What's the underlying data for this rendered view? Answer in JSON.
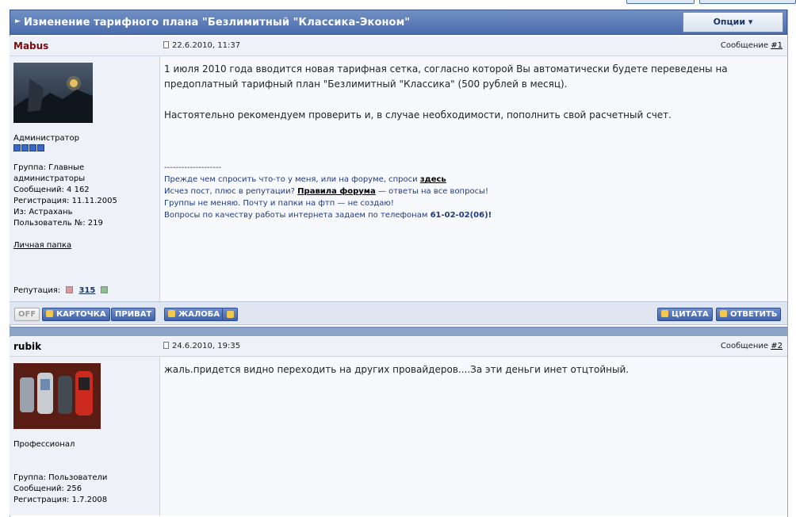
{
  "topic": {
    "title": "Изменение тарифного плана \"Безлимитный \"Классика-Эконом\"",
    "options_label": "Опции ▾"
  },
  "posts": [
    {
      "author": "Mabus",
      "date": "22.6.2010, 11:37",
      "msg_label": "Сообщение",
      "msg_num": "#1",
      "rank": "Администратор",
      "group": "Группа: Главные администраторы",
      "messages": "Сообщений: 4 162",
      "registered": "Регистрация: 11.11.2005",
      "from": "Из: Астрахань",
      "user_no": "Пользователь №: 219",
      "folder": "Личная папка",
      "rep_label": "Репутация:",
      "rep_value": "315",
      "body_1": "1 июля 2010 года вводится новая тарифная сетка, согласно которой Вы автоматически будете переведены на",
      "body_2": "предоплатный тарифный план \"Безлимитный \"Классика\" (500 рублей в месяц).",
      "body_3": "Настоятельно рекомендуем проверить и, в случае необходимости, пополнить свой расчетный счет.",
      "sig_dash": "--------------------",
      "sig_1a": "Прежде чем спросить что-то у меня, или на форуме, спроси ",
      "sig_1b": "здесь",
      "sig_2a": "Исчез пост, плюс в репутации? ",
      "sig_2b": "Правила форума",
      "sig_2c": " — ответы на все вопросы!",
      "sig_3": "Группы не меняю. Почту и папки на фтп — не создаю!",
      "sig_4a": "Вопросы по качеству работы интернета задаем по телефонам ",
      "sig_4b": "61-02-02(06)!",
      "buttons": {
        "off": "OFF",
        "card": "КАРТОЧКА",
        "private": "ПРИВАТ",
        "report": "ЖАЛОБА",
        "quote": "ЦИТАТА",
        "reply": "ОТВЕТИТЬ"
      }
    },
    {
      "author": "rubik",
      "date": "24.6.2010, 19:35",
      "msg_label": "Сообщение",
      "msg_num": "#2",
      "rank": "Профессионал",
      "group": "Группа: Пользователи",
      "messages": "Сообщений: 256",
      "registered": "Регистрация: 1.7.2008",
      "body_1": "жаль.придется видно переходить на других провайдеров....За эти деньги инет отцтойный."
    }
  ],
  "colors": {
    "title_bar": "#5a7bb8",
    "admin_name": "#7a0c0c",
    "button_blue": "#4f70b8",
    "signature": "#1f3a84"
  },
  "icons": [
    "document-icon",
    "rank-pip-icon",
    "reputation-minus-icon",
    "reputation-plus-icon",
    "user-icon",
    "warning-icon",
    "arrow-up-icon",
    "plus-icon",
    "quote-icon"
  ]
}
